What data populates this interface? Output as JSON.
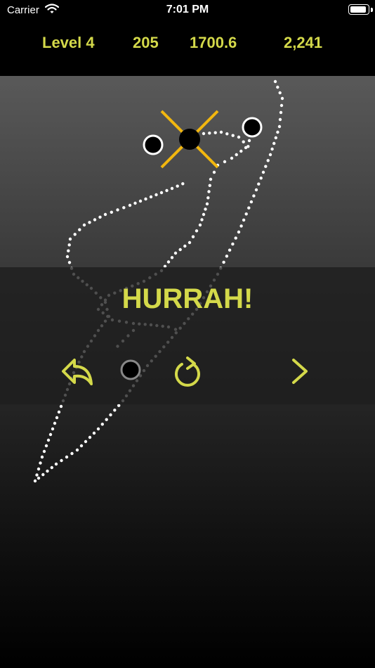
{
  "status_bar": {
    "carrier": "Carrier",
    "time": "7:01 PM"
  },
  "score_bar": {
    "level": "Level 4",
    "score_a": "205",
    "score_b": "1700.6",
    "score_c": "2,241"
  },
  "message": "HURRAH!",
  "colors": {
    "accent": "#d4d94a",
    "target_cross": "#f2b70f",
    "dot": "#ffffff"
  },
  "controls": {
    "undo": "undo-icon",
    "marker": "circle-icon",
    "restart": "restart-icon",
    "next": "chevron-right-icon"
  }
}
